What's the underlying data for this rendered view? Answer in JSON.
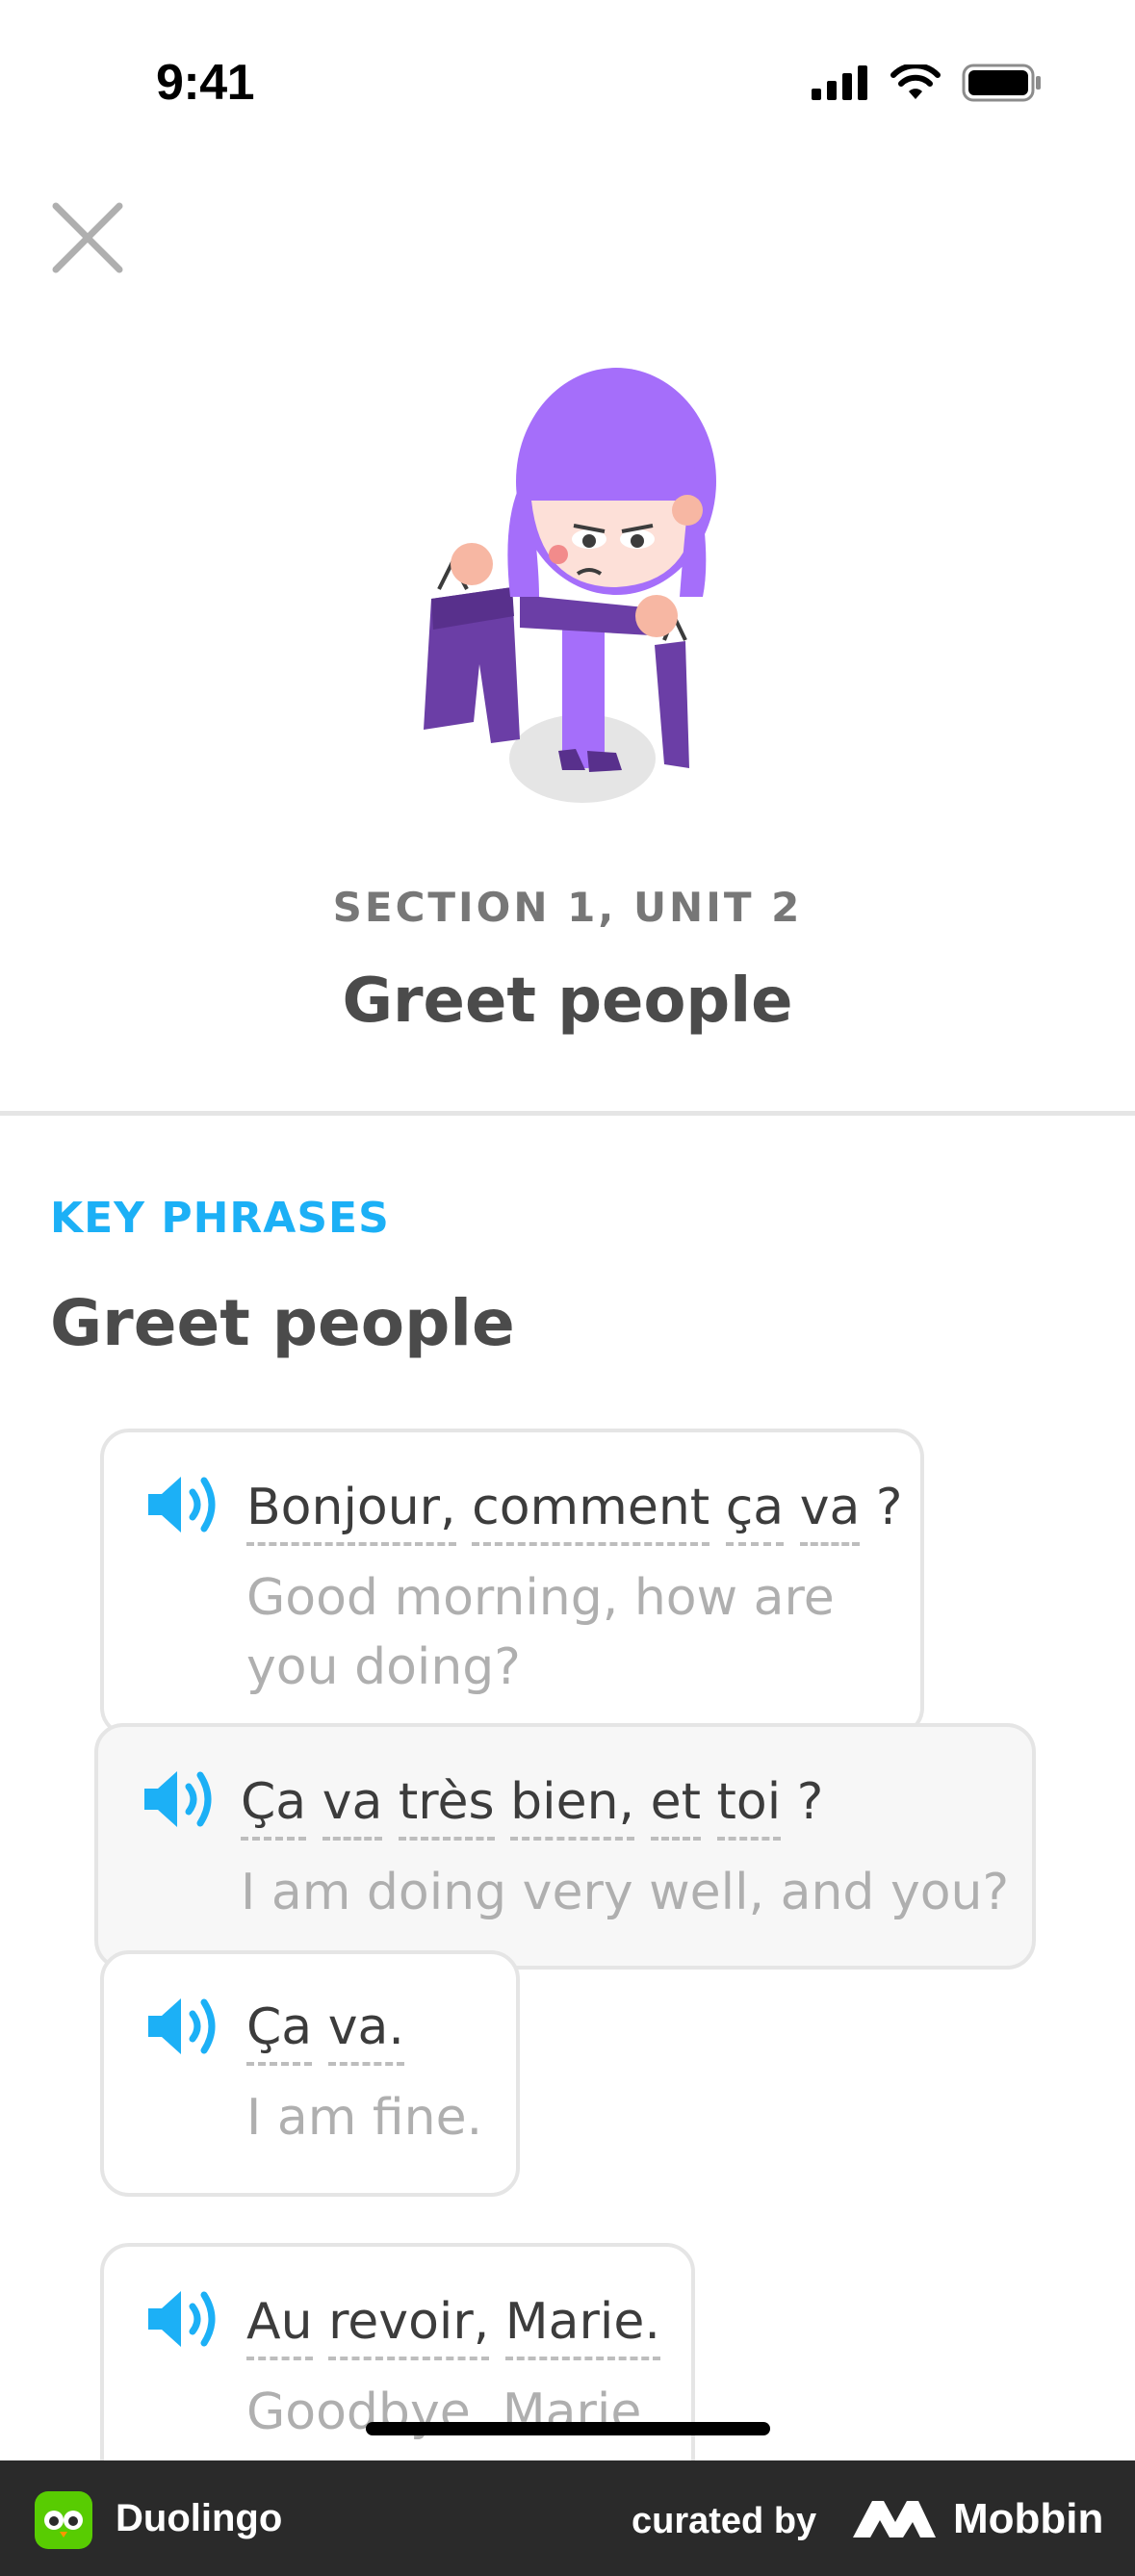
{
  "status": {
    "time": "9:41"
  },
  "header": {
    "section": "SECTION 1, UNIT 2",
    "title": "Greet people"
  },
  "key_phrases": {
    "label": "KEY PHRASES",
    "title": "Greet people",
    "dialog": [
      {
        "words": [
          "Bonjour,",
          "comment",
          "ça",
          "va",
          "?"
        ],
        "translation_lines": [
          "Good morning, how are",
          "you doing?"
        ],
        "side": "left"
      },
      {
        "words": [
          "Ça",
          "va",
          "très",
          "bien,",
          "et",
          "toi",
          "?"
        ],
        "translation_lines": [
          "I am doing very well, and you?"
        ],
        "side": "right"
      },
      {
        "words": [
          "Ça",
          "va."
        ],
        "translation_lines": [
          "I am fine."
        ],
        "side": "left"
      },
      {
        "words": [
          "Au",
          "revoir,",
          "Marie."
        ],
        "translation_lines": [
          "Goodbye, Marie."
        ],
        "side": "left"
      }
    ]
  },
  "footer": {
    "app_name": "Duolingo",
    "curated_by": "curated by",
    "brand": "Mobbin"
  },
  "colors": {
    "accent": "#1cb0f6",
    "character_hair": "#a56efa",
    "character_clothes": "#6b3ea6"
  }
}
